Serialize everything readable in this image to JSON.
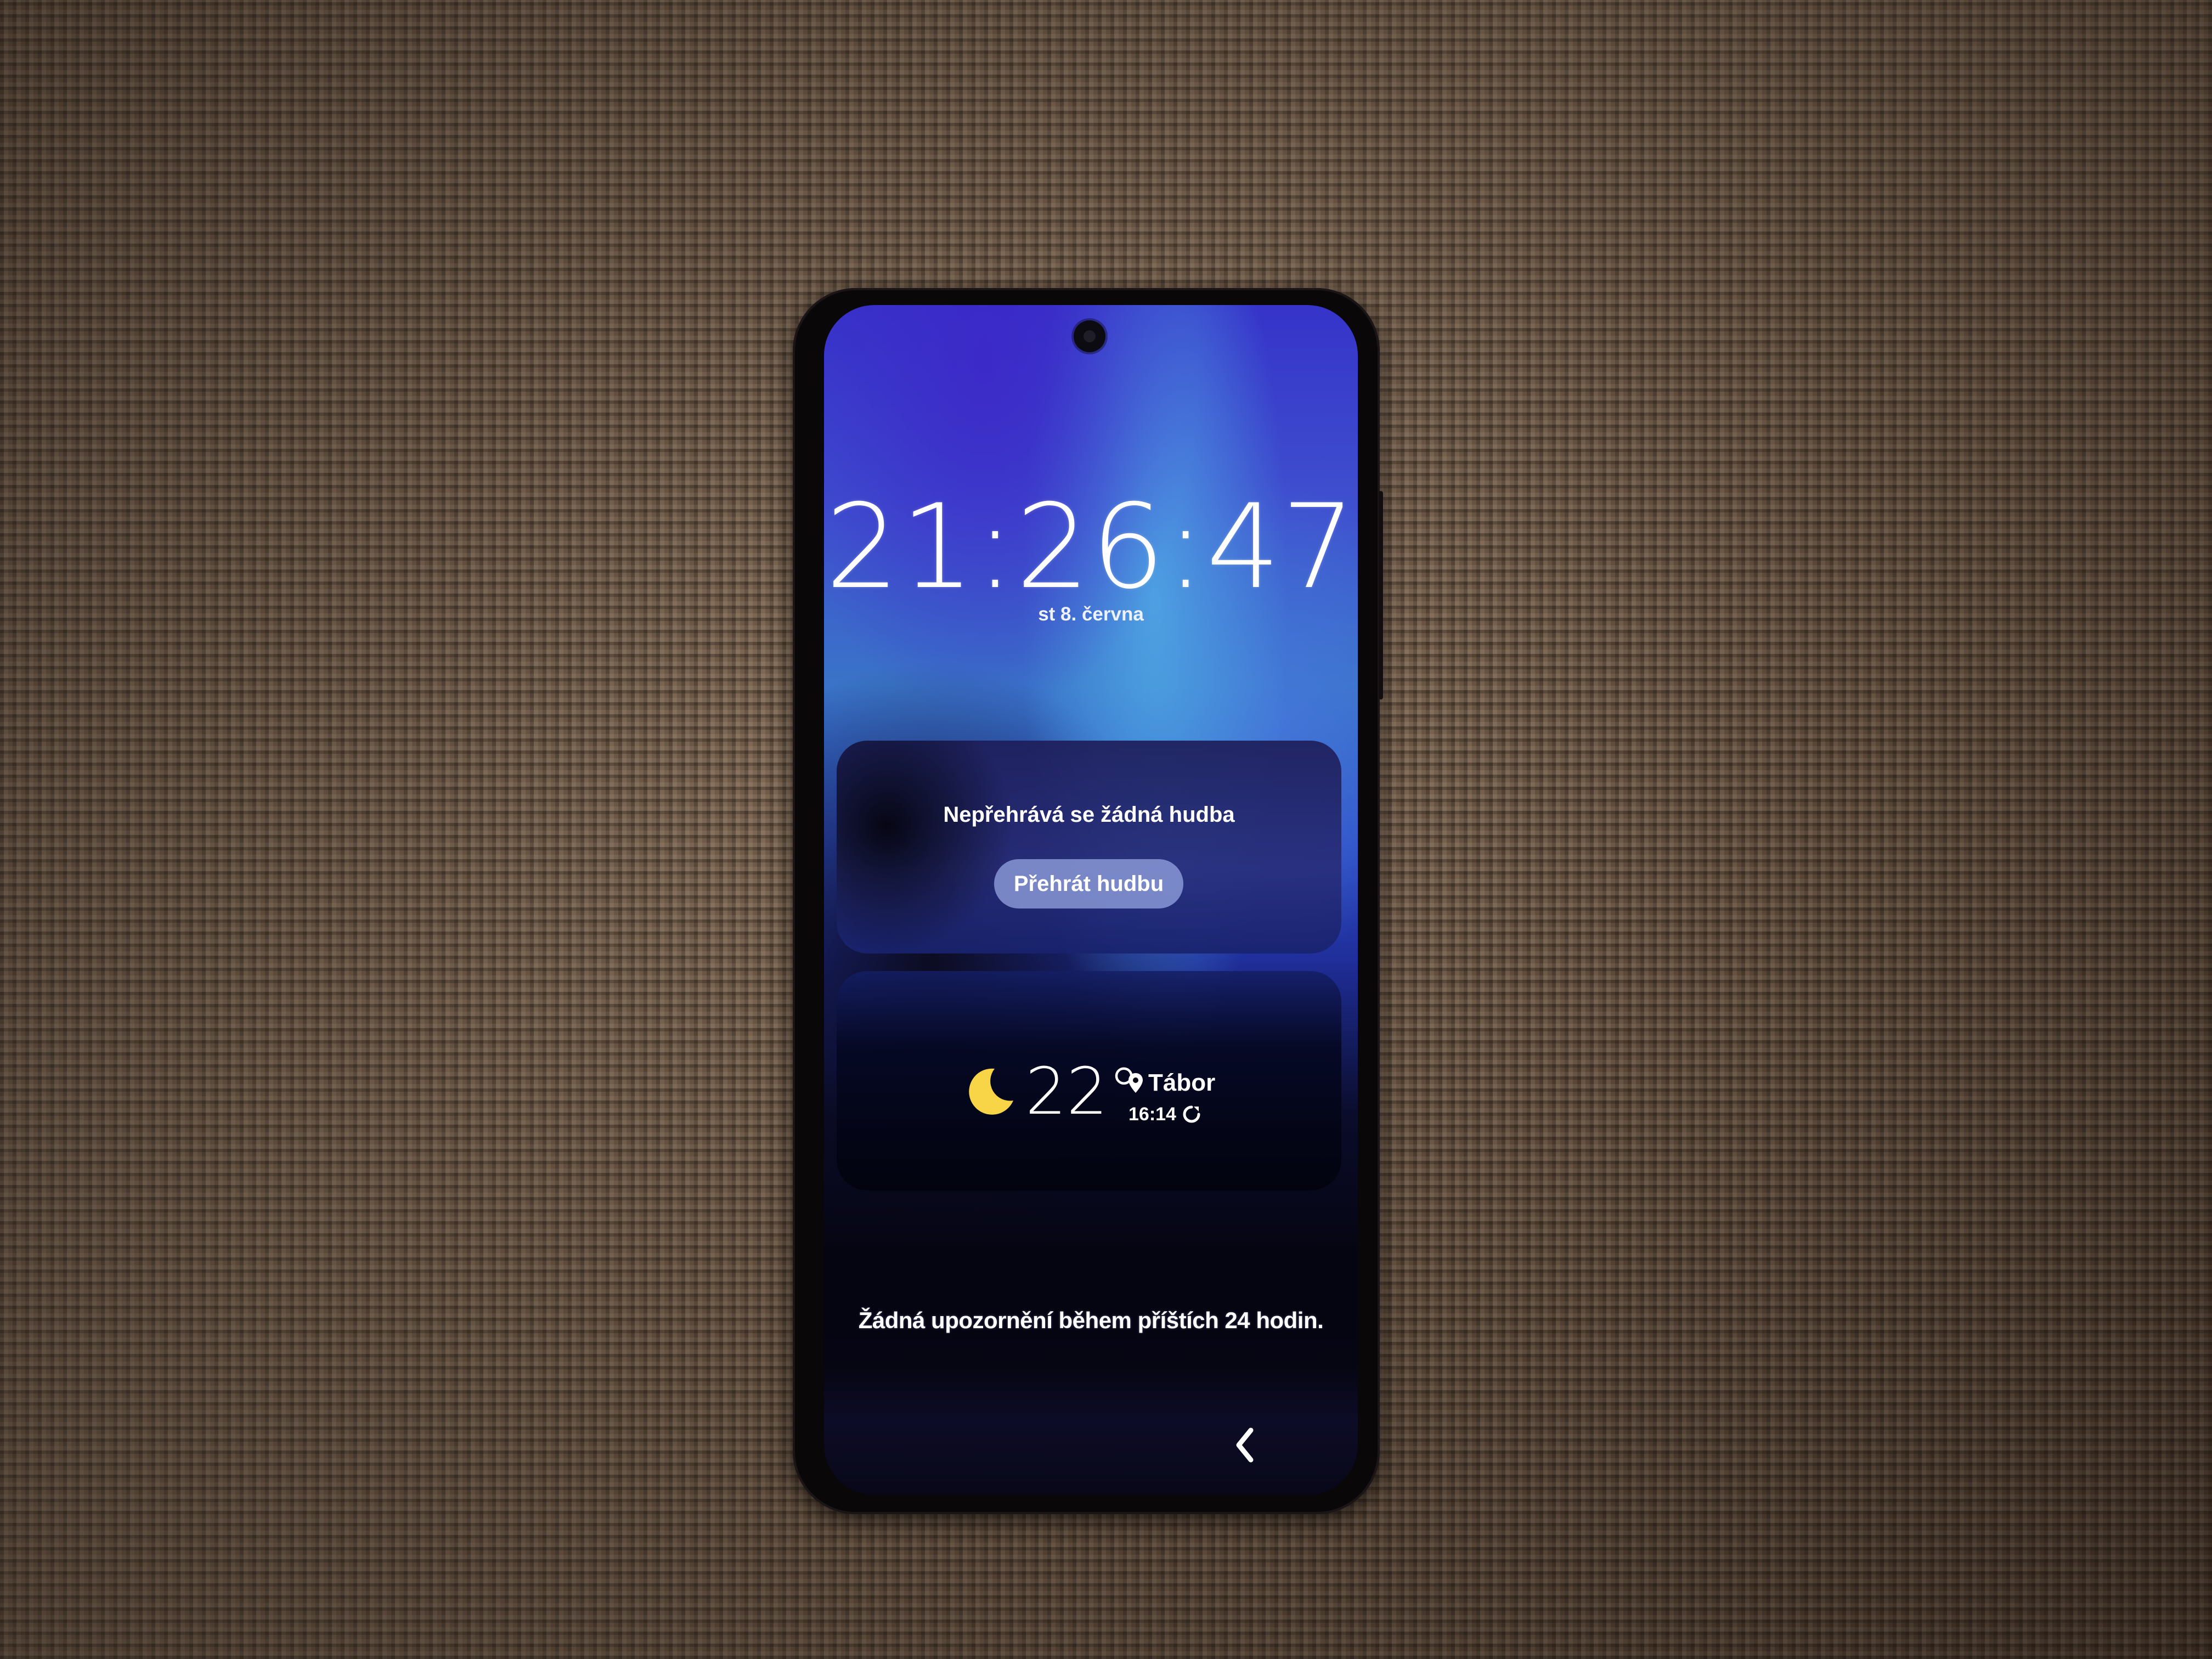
{
  "device": "smartphone",
  "lock_screen": {
    "clock": {
      "time": "21:26:47",
      "date": "st 8. června"
    },
    "music_widget": {
      "status": "Nepřehrává se žádná hudba",
      "play_button_label": "Přehrát hudbu"
    },
    "weather_widget": {
      "condition_icon": "crescent-moon-icon",
      "temperature": "22°",
      "location_icon": "map-pin-icon",
      "location": "Tábor",
      "updated_time": "16:14",
      "refresh_icon": "refresh-icon",
      "moon_color": "#f7d547"
    },
    "notifications": {
      "empty_message": "Žádná upozornění během příštích 24 hodin."
    },
    "navigation": {
      "back_icon": "chevron-left-icon"
    }
  },
  "colors": {
    "wallpaper_top": "#3633c9",
    "wallpaper_mid": "#3a74c8",
    "wallpaper_bottom": "#050511",
    "text": "#ffffff",
    "button_bg": "#96a5e1"
  }
}
